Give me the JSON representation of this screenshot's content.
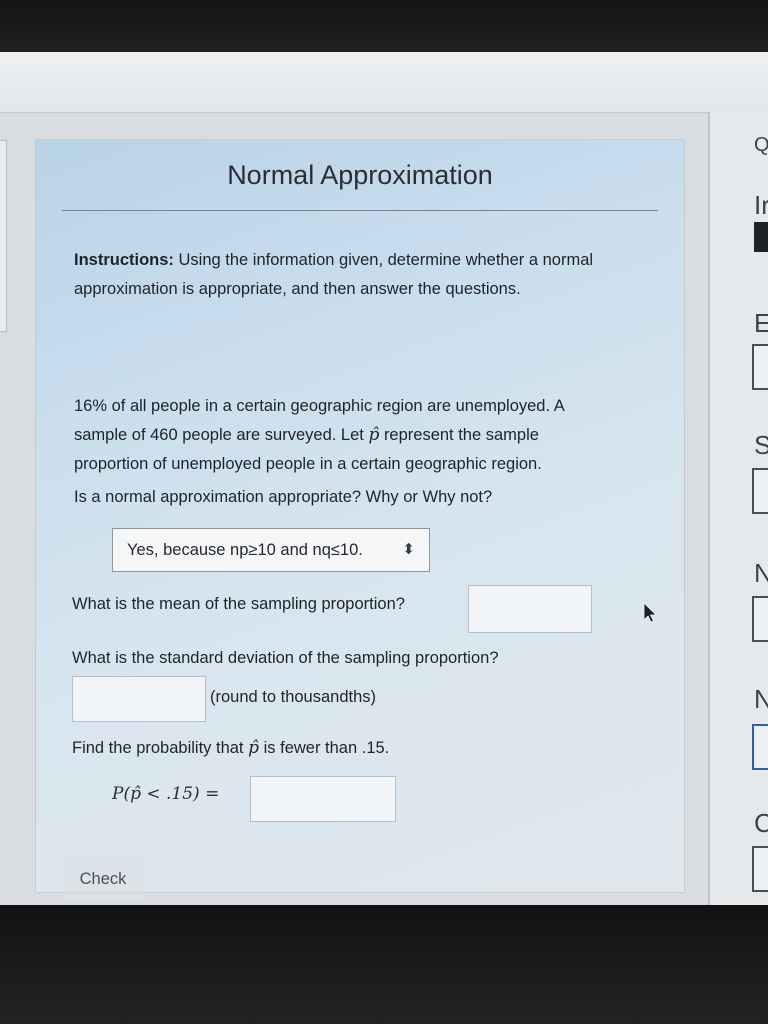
{
  "page": {
    "title": "Normal Approximation"
  },
  "instructions": {
    "label": "Instructions:",
    "text": "Using the information given, determine whether a normal approximation is appropriate, and then answer the questions."
  },
  "problem": {
    "line1": "16% of all people in a certain geographic region are unemployed. A",
    "line2": "sample of 460 people are surveyed. Let",
    "phat": "p̂",
    "line2b": "represent the sample",
    "line3": "proportion of unemployed people in a certain geographic region."
  },
  "questions": {
    "q1": "Is a normal approximation appropriate? Why or Why not?",
    "q1_selected": "Yes, because np≥10 and nq≤10.",
    "q2": "What is the mean of the sampling proportion?",
    "q2_value": "",
    "q3": "What is the standard deviation of the sampling proportion?",
    "q3_value": "",
    "q3_note": "(round to thousandths)",
    "q4_pre": "Find the probability that",
    "q4_phat": "p̂",
    "q4_post": "is fewer than .15.",
    "q4_expr": "P(p̂ < .15) =",
    "q4_value": ""
  },
  "buttons": {
    "check": "Check"
  },
  "sidebar": {
    "letters": [
      "Q",
      "Ir",
      "E",
      "S",
      "N",
      "N",
      "C"
    ]
  },
  "colors": {
    "panel_top": "#b9d3e8",
    "panel_bottom": "#e0e7ec",
    "text": "#1f2328",
    "input_border": "#b7bec5"
  }
}
